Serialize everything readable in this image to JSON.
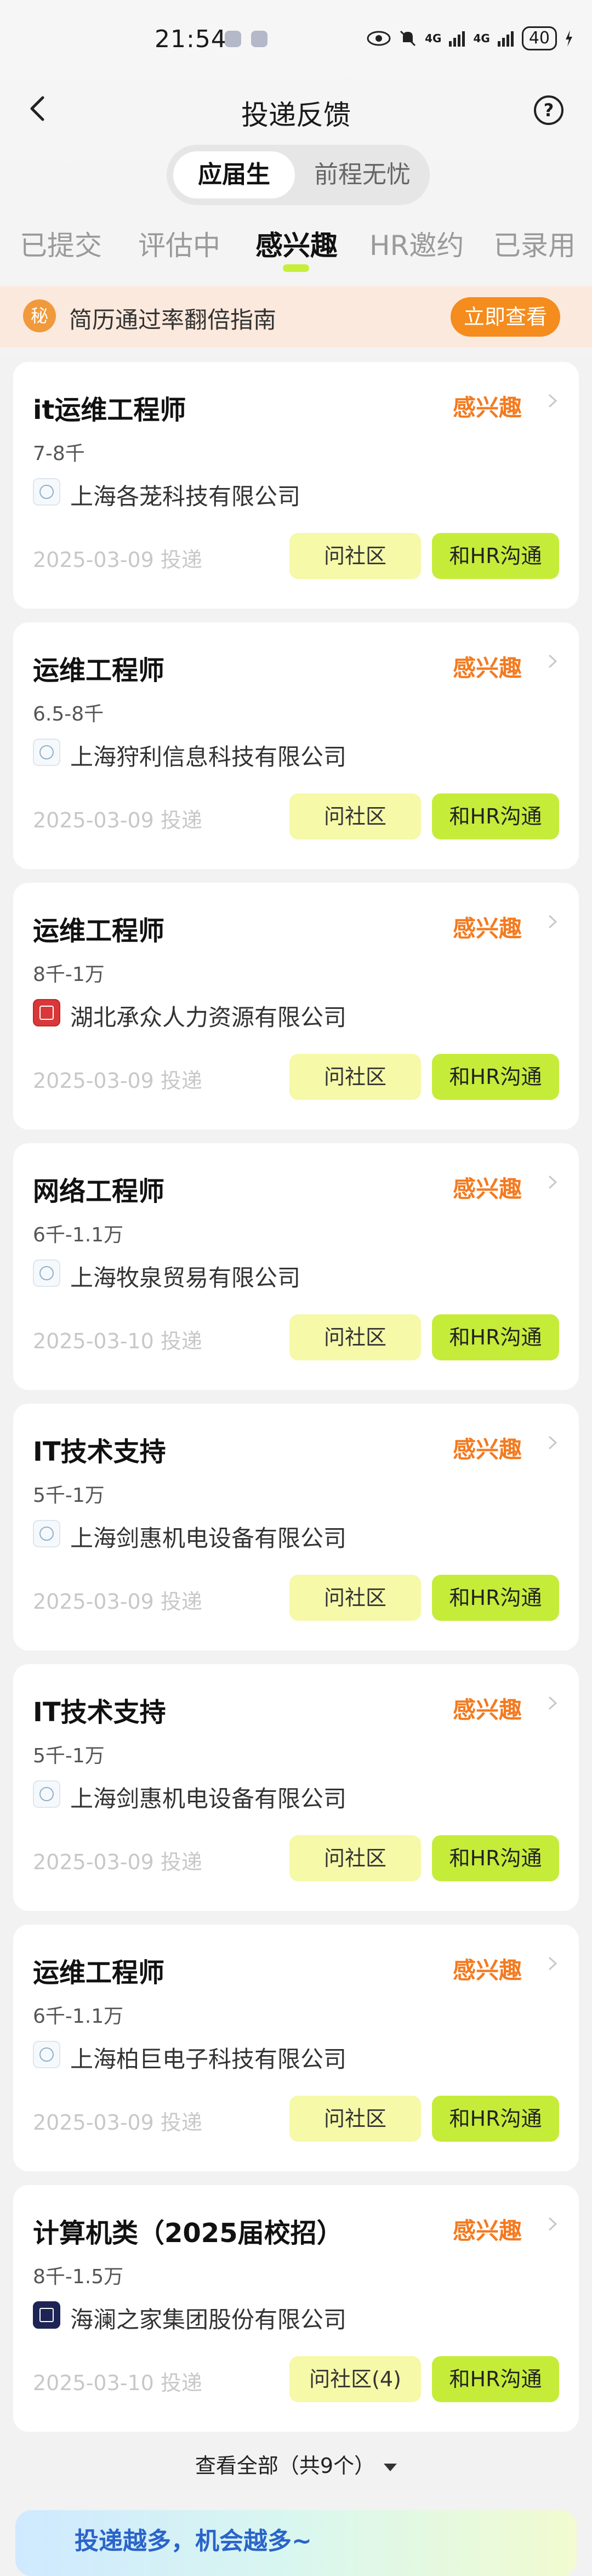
{
  "status_bar": {
    "time": "21:54",
    "signal1": "4G",
    "signal2": "4G",
    "battery": "40"
  },
  "header": {
    "title": "投递反馈",
    "help_icon": "?"
  },
  "segment": {
    "options": [
      "应届生",
      "前程无忧"
    ],
    "selected": "应届生"
  },
  "tabs": {
    "items": [
      "已提交",
      "评估中",
      "感兴趣",
      "HR邀约",
      "已录用"
    ],
    "active": "感兴趣"
  },
  "banner": {
    "badge": "秘",
    "text": "简历通过率翻倍指南",
    "button": "立即查看"
  },
  "cards": [
    {
      "title": "it运维工程师",
      "status": "感兴趣",
      "salary": "7-8千",
      "company": "上海各茏科技有限公司",
      "date": "2025-03-09 投递",
      "ask_label": "问社区",
      "hr_label": "和HR沟通"
    },
    {
      "title": "运维工程师",
      "status": "感兴趣",
      "salary": "6.5-8千",
      "company": "上海狩利信息科技有限公司",
      "date": "2025-03-09 投递",
      "ask_label": "问社区",
      "hr_label": "和HR沟通"
    },
    {
      "title": "运维工程师",
      "status": "感兴趣",
      "salary": "8千-1万",
      "company": "湖北承众人力资源有限公司",
      "date": "2025-03-09 投递",
      "ask_label": "问社区",
      "hr_label": "和HR沟通"
    },
    {
      "title": "网络工程师",
      "status": "感兴趣",
      "salary": "6千-1.1万",
      "company": "上海牧泉贸易有限公司",
      "date": "2025-03-10 投递",
      "ask_label": "问社区",
      "hr_label": "和HR沟通"
    },
    {
      "title": "IT技术支持",
      "status": "感兴趣",
      "salary": "5千-1万",
      "company": "上海剑惠机电设备有限公司",
      "date": "2025-03-09 投递",
      "ask_label": "问社区",
      "hr_label": "和HR沟通"
    },
    {
      "title": "IT技术支持",
      "status": "感兴趣",
      "salary": "5千-1万",
      "company": "上海剑惠机电设备有限公司",
      "date": "2025-03-09 投递",
      "ask_label": "问社区",
      "hr_label": "和HR沟通"
    },
    {
      "title": "运维工程师",
      "status": "感兴趣",
      "salary": "6千-1.1万",
      "company": "上海柏巨电子科技有限公司",
      "date": "2025-03-09 投递",
      "ask_label": "问社区",
      "hr_label": "和HR沟通"
    },
    {
      "title": "计算机类（2025届校招）",
      "status": "感兴趣",
      "salary": "8千-1.5万",
      "company": "海澜之家集团股份有限公司",
      "date": "2025-03-10 投递",
      "ask_label": "问社区(4)",
      "hr_label": "和HR沟通"
    }
  ],
  "see_all": "查看全部（共9个）",
  "promo": {
    "text": "投递越多，机会越多~"
  }
}
